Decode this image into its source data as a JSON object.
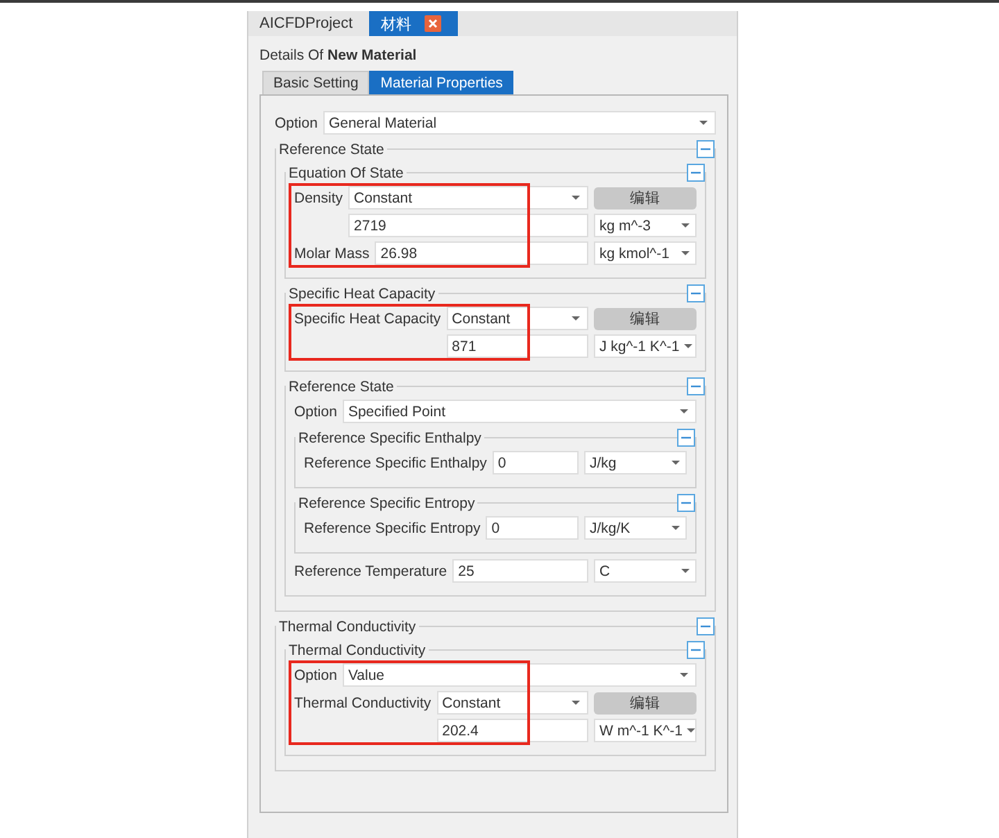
{
  "doc_tabs": [
    {
      "label": "AICFDProject",
      "selected": false,
      "closable": false
    },
    {
      "label": "材料",
      "selected": true,
      "closable": true
    }
  ],
  "details": "Details Of **New Material**",
  "tabs": [
    {
      "label": "Basic Setting",
      "selected": false
    },
    {
      "label": "Material Properties",
      "selected": true
    }
  ],
  "option": {
    "label": "Option",
    "value": "General Material"
  },
  "sections": [
    {
      "kind": "section",
      "title": "Reference State",
      "expanded": true,
      "items": [
        {
          "kind": "section",
          "title": "Equation Of State",
          "expanded": true,
          "highlighted": true,
          "items": [
            {
              "kind": "method",
              "label": "Density",
              "value": "Constant",
              "button": "编辑",
              "amount": "2719",
              "unit": "kg m^-3"
            },
            {
              "kind": "quantity",
              "label": "Molar Mass",
              "value": "26.98",
              "unit": "kg kmol^-1"
            }
          ]
        },
        {
          "kind": "section",
          "title": "Specific Heat Capacity",
          "expanded": true,
          "highlighted": true,
          "items": [
            {
              "kind": "method",
              "label": "Specific Heat Capacity",
              "value": "Constant",
              "button": "编辑",
              "amount": "871",
              "unit": "J kg^-1 K^-1"
            }
          ]
        },
        {
          "kind": "section",
          "title": "Reference State",
          "expanded": true,
          "items": [
            {
              "kind": "select",
              "label": "Option",
              "value": "Specified Point"
            },
            {
              "kind": "section",
              "title": "Reference Specific Enthalpy",
              "expanded": true,
              "items": [
                {
                  "kind": "quantity",
                  "label": "Reference Specific Enthalpy",
                  "value": "0",
                  "unit": "J/kg"
                }
              ]
            },
            {
              "kind": "section",
              "title": "Reference Specific Entropy",
              "expanded": true,
              "items": [
                {
                  "kind": "quantity",
                  "label": "Reference Specific Entropy",
                  "value": "0",
                  "unit": "J/kg/K"
                }
              ]
            },
            {
              "kind": "quantity",
              "label": "Reference Temperature",
              "value": "25",
              "unit": "C"
            }
          ]
        }
      ]
    },
    {
      "kind": "section",
      "title": "Thermal Conductivity",
      "expanded": true,
      "items": [
        {
          "kind": "section",
          "title": "Thermal Conductivity",
          "expanded": true,
          "highlighted": true,
          "items": [
            {
              "kind": "select",
              "label": "Option",
              "value": "Value"
            },
            {
              "kind": "method",
              "label": "Thermal Conductivity",
              "value": "Constant",
              "button": "编辑",
              "amount": "202.4",
              "unit": "W m^-1 K^-1"
            }
          ]
        }
      ]
    }
  ]
}
